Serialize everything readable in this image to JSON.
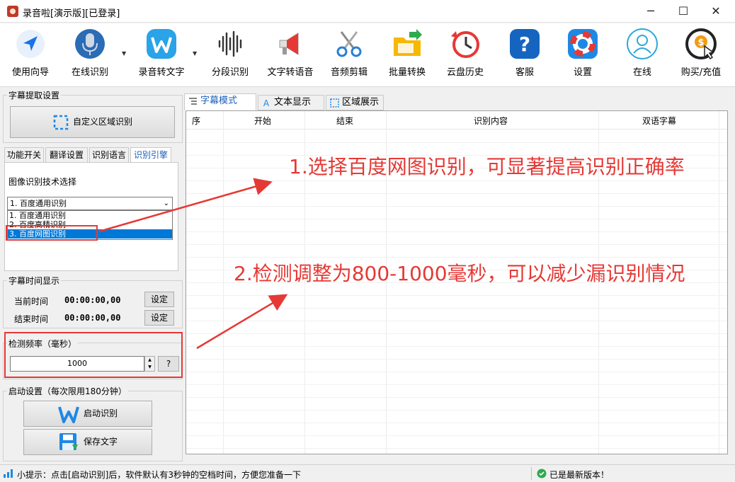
{
  "window": {
    "title": "录音啦[演示版][已登录]",
    "min_glyph": "─",
    "max_glyph": "☐",
    "close_glyph": "✕"
  },
  "toolbar": {
    "items": [
      {
        "label": "使用向导",
        "icon": "navigation-arrow-icon"
      },
      {
        "label": "在线识别",
        "icon": "microphone-icon"
      },
      {
        "label": "录音转文字",
        "icon": "w-logo-icon"
      },
      {
        "label": "分段识别",
        "icon": "waveform-icon"
      },
      {
        "label": "文字转语音",
        "icon": "megaphone-icon"
      },
      {
        "label": "音频剪辑",
        "icon": "scissors-icon"
      },
      {
        "label": "批量转换",
        "icon": "folder-icon"
      },
      {
        "label": "云盘历史",
        "icon": "history-clock-icon"
      },
      {
        "label": "客服",
        "icon": "help-icon"
      },
      {
        "label": "设置",
        "icon": "lifebuoy-icon"
      },
      {
        "label": "在线",
        "icon": "user-online-icon"
      },
      {
        "label": "购买/充值",
        "icon": "purchase-icon"
      }
    ],
    "dropdown_glyph": "▼"
  },
  "left": {
    "subtitle_group": "字幕提取设置",
    "custom_region_button": "自定义区域识别",
    "tabs": [
      "功能开关",
      "翻译设置",
      "识别语言",
      "识别引擎"
    ],
    "active_tab": "识别引擎",
    "engine_group_label": "图像识别技术选择",
    "combo_value": "1. 百度通用识别",
    "combo_arrow": "⌄",
    "dropdown_options": [
      "1. 百度通用识别",
      "2. 百度高精识别",
      "3. 百度网图识别"
    ],
    "selected_option_index": 2,
    "time_group": "字幕时间显示",
    "current_time_label": "当前时间",
    "current_time_value": "00:00:00,00",
    "end_time_label": "结束时间",
    "end_time_value": "00:00:00,00",
    "set_button": "设定",
    "freq_label": "检测频率（毫秒）",
    "freq_value": "1000",
    "help_button": "?",
    "startup_group": "启动设置（每次限用180分钟）",
    "start_button": "启动识别",
    "save_button": "保存文字"
  },
  "right": {
    "tabs": [
      "字幕模式",
      "文本显示",
      "区域展示"
    ],
    "active_tab": "字幕模式",
    "columns": [
      "序",
      "开始",
      "结束",
      "识别内容",
      "双语字幕"
    ]
  },
  "annotations": {
    "note1": "1.选择百度网图识别，可显著提高识别正确率",
    "note2": "2.检测调整为800-1000毫秒，可以减少漏识别情况",
    "color": "#e53935"
  },
  "status": {
    "tip": "小提示：点击[启动识别]后，软件默认有3秒钟的空档时间，方便您准备一下",
    "version": "已是最新版本！"
  }
}
